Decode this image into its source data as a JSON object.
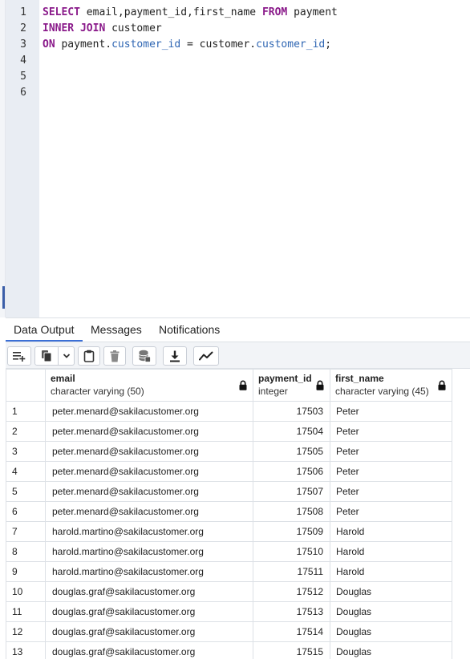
{
  "editor": {
    "line_numbers": [
      "1",
      "2",
      "3",
      "4",
      "5",
      "6"
    ],
    "line1": {
      "kw1": "SELECT",
      "t1": " email,payment_id,first_name ",
      "kw2": "FROM",
      "t2": " payment"
    },
    "line2": {
      "kw1": "INNER JOIN",
      "t1": " customer"
    },
    "line3": {
      "kw1": "ON",
      "t1": " payment.",
      "p1": "customer_id",
      "t2": " = customer.",
      "p2": "customer_id",
      "t3": ";"
    }
  },
  "tabs": [
    {
      "label": "Data Output",
      "active": true
    },
    {
      "label": "Messages",
      "active": false
    },
    {
      "label": "Notifications",
      "active": false
    }
  ],
  "toolbar": {
    "icons": [
      "add-row-icon",
      "copy-icon",
      "chevron-down-icon",
      "paste-icon",
      "delete-icon",
      "save-data-icon",
      "download-icon",
      "graph-icon"
    ]
  },
  "grid": {
    "columns": [
      {
        "name": "email",
        "type": "character varying (50)"
      },
      {
        "name": "payment_id",
        "type": "integer"
      },
      {
        "name": "first_name",
        "type": "character varying (45)"
      }
    ],
    "rows": [
      {
        "num": "1",
        "email": "peter.menard@sakilacustomer.org",
        "payment_id": "17503",
        "first_name": "Peter"
      },
      {
        "num": "2",
        "email": "peter.menard@sakilacustomer.org",
        "payment_id": "17504",
        "first_name": "Peter"
      },
      {
        "num": "3",
        "email": "peter.menard@sakilacustomer.org",
        "payment_id": "17505",
        "first_name": "Peter"
      },
      {
        "num": "4",
        "email": "peter.menard@sakilacustomer.org",
        "payment_id": "17506",
        "first_name": "Peter"
      },
      {
        "num": "5",
        "email": "peter.menard@sakilacustomer.org",
        "payment_id": "17507",
        "first_name": "Peter"
      },
      {
        "num": "6",
        "email": "peter.menard@sakilacustomer.org",
        "payment_id": "17508",
        "first_name": "Peter"
      },
      {
        "num": "7",
        "email": "harold.martino@sakilacustomer.org",
        "payment_id": "17509",
        "first_name": "Harold"
      },
      {
        "num": "8",
        "email": "harold.martino@sakilacustomer.org",
        "payment_id": "17510",
        "first_name": "Harold"
      },
      {
        "num": "9",
        "email": "harold.martino@sakilacustomer.org",
        "payment_id": "17511",
        "first_name": "Harold"
      },
      {
        "num": "10",
        "email": "douglas.graf@sakilacustomer.org",
        "payment_id": "17512",
        "first_name": "Douglas"
      },
      {
        "num": "11",
        "email": "douglas.graf@sakilacustomer.org",
        "payment_id": "17513",
        "first_name": "Douglas"
      },
      {
        "num": "12",
        "email": "douglas.graf@sakilacustomer.org",
        "payment_id": "17514",
        "first_name": "Douglas"
      },
      {
        "num": "13",
        "email": "douglas.graf@sakilacustomer.org",
        "payment_id": "17515",
        "first_name": "Douglas"
      }
    ]
  },
  "colors": {
    "keyword": "#8a1a8a",
    "property": "#2f66b3",
    "active_tab_underline": "#3b6fd6",
    "gutter": "#e9edf3"
  }
}
